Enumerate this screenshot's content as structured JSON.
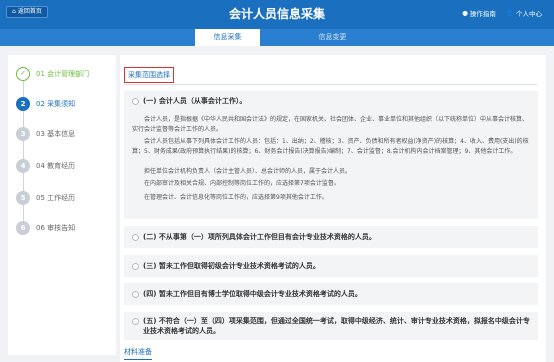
{
  "header": {
    "home_label": "返回首页",
    "title": "会计人员信息采集",
    "guide_label": "操作指南",
    "user_center_label": "个人中心"
  },
  "tabs": [
    {
      "label": "信息采集",
      "active": true
    },
    {
      "label": "信息变更",
      "active": false
    }
  ],
  "steps": [
    {
      "number": "✓",
      "label": "01 会计管理部门",
      "state": "done"
    },
    {
      "number": "2",
      "label": "02 采集须知",
      "state": "active"
    },
    {
      "number": "3",
      "label": "03 基本信息",
      "state": "pending"
    },
    {
      "number": "4",
      "label": "04 教育经历",
      "state": "pending"
    },
    {
      "number": "5",
      "label": "05 工作经历",
      "state": "pending"
    },
    {
      "number": "6",
      "label": "06 审核告知",
      "state": "pending"
    }
  ],
  "main": {
    "section_title": "采集范围选择",
    "option1": {
      "title": "(一) 会计人员（从事会计工作）。",
      "paragraphs": [
        "会计人员，是指根据《中华人民共和国会计法》的规定，在国家机关、社会团体、企业、事业单位和其他组织（以下统称单位）中从事会计核算、实行会计监督等会计工作的人员。",
        "会计人员包括从事下列具体会计工作的人员：包括：1、出纳；2、稽核；3、资产、负债和所有者权益(净资产)的核算；4、收入、费用(支出)的核算；5、财务成果(政府预算执行结果)的核算；6、财务会计报告(决算报告)编制；7、会计监督；8.会计机构内会计档案管理；9、其他会计工作。",
        "担任单位会计机构负责人（会计主管人员）、总会计师的人员，属于会计人员。",
        "在内部审计及相关合规、内部控制等岗位工作的，应选择第7项会计监督。",
        "在管理会计、会计信息化等岗位工作的，应选择第9项其他会计工作。"
      ]
    },
    "option2": "(二) 不从事第（一）项所列具体会计工作但目有会计专业技术资格的人员。",
    "option3": "(三) 暂未工作但取得初级会计专业技术资格考试的人员。",
    "option4": "(四) 暂未工作但目有博士学位取得中级会计专业技术资格考试的人员。",
    "option5": "(五) 不符合（一）至（四）项采集范围，但通过全国统一考试，取得中级经济、统计、审计专业技术资格，拟报名中级会计专业技术资格考试的人员。",
    "footer_section": "材料准备"
  },
  "colors": {
    "primary": "#1a6fbf",
    "done": "#6bbf3a",
    "highlight_border": "#e0322c"
  }
}
